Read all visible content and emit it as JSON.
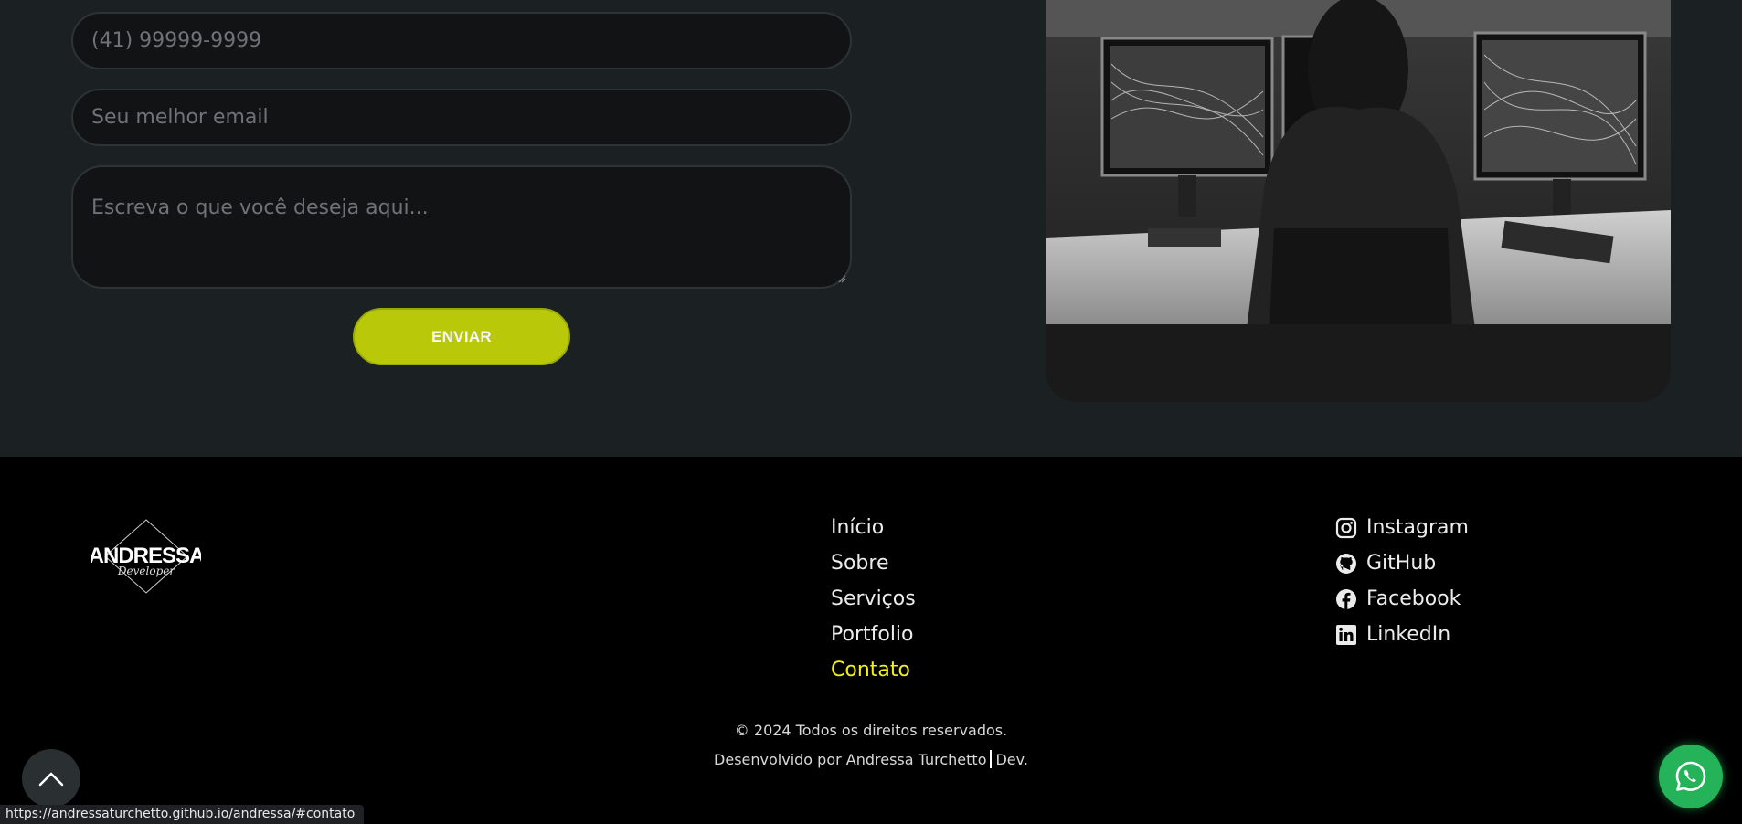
{
  "form": {
    "phone_placeholder": "(41) 99999-9999",
    "email_placeholder": "Seu melhor email",
    "message_placeholder": "Escreva o que você deseja aqui...",
    "submit_label": "ENVIAR"
  },
  "logo": {
    "name": "ANDRESSA",
    "subtitle": "Developer"
  },
  "footer_nav": [
    {
      "label": "Início"
    },
    {
      "label": "Sobre"
    },
    {
      "label": "Serviços"
    },
    {
      "label": "Portfolio"
    },
    {
      "label": "Contato",
      "active": true
    }
  ],
  "social": [
    {
      "label": "Instagram",
      "icon": "instagram-icon"
    },
    {
      "label": "GitHub",
      "icon": "github-icon"
    },
    {
      "label": "Facebook",
      "icon": "facebook-icon"
    },
    {
      "label": "LinkedIn",
      "icon": "linkedin-icon"
    }
  ],
  "copyright": {
    "line1": "© 2024 Todos os direitos reservados.",
    "line2_prefix": "Desenvolvido por Andressa Turchetto",
    "line2_suffix": "Dev."
  },
  "status_bar": {
    "url": "https://andressaturchetto.github.io/andressa/#contato"
  },
  "colors": {
    "accent": "#b9c90a",
    "active_link": "#f3ef17",
    "whatsapp": "#25b35a",
    "section_bg": "#1b2022",
    "footer_bg": "#000000"
  }
}
